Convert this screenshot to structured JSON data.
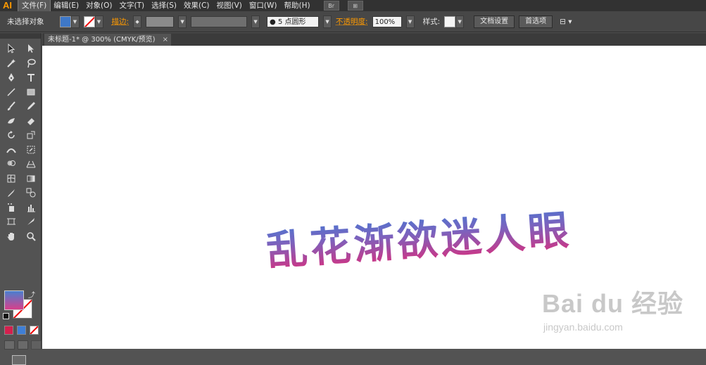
{
  "app": {
    "logo": "AI"
  },
  "menu": [
    {
      "label": "文件(F)",
      "active": true
    },
    {
      "label": "编辑(E)"
    },
    {
      "label": "对象(O)"
    },
    {
      "label": "文字(T)"
    },
    {
      "label": "选择(S)"
    },
    {
      "label": "效果(C)"
    },
    {
      "label": "视图(V)"
    },
    {
      "label": "窗口(W)"
    },
    {
      "label": "帮助(H)"
    }
  ],
  "menu_icons": [
    "Br",
    "⊞"
  ],
  "control": {
    "selection_status": "未选择对象",
    "stroke_label": "描边:",
    "brush_value": "5 点圆形",
    "opacity_label": "不透明度:",
    "opacity_value": "100%",
    "style_label": "样式:",
    "doc_setup": "文档设置",
    "prefs": "首选项"
  },
  "document": {
    "tab_title": "未标题-1* @ 300% (CMYK/预览)",
    "close": "×"
  },
  "canvas": {
    "artwork_text": "乱花渐欲迷人眼"
  },
  "watermark": {
    "main": "Bai du 经验",
    "sub": "jingyan.baidu.com"
  },
  "colors": {
    "fill_gradient_top": "#4a7fd0",
    "fill_gradient_bottom": "#d83f8a",
    "menu_accent": "#ff9a00"
  }
}
